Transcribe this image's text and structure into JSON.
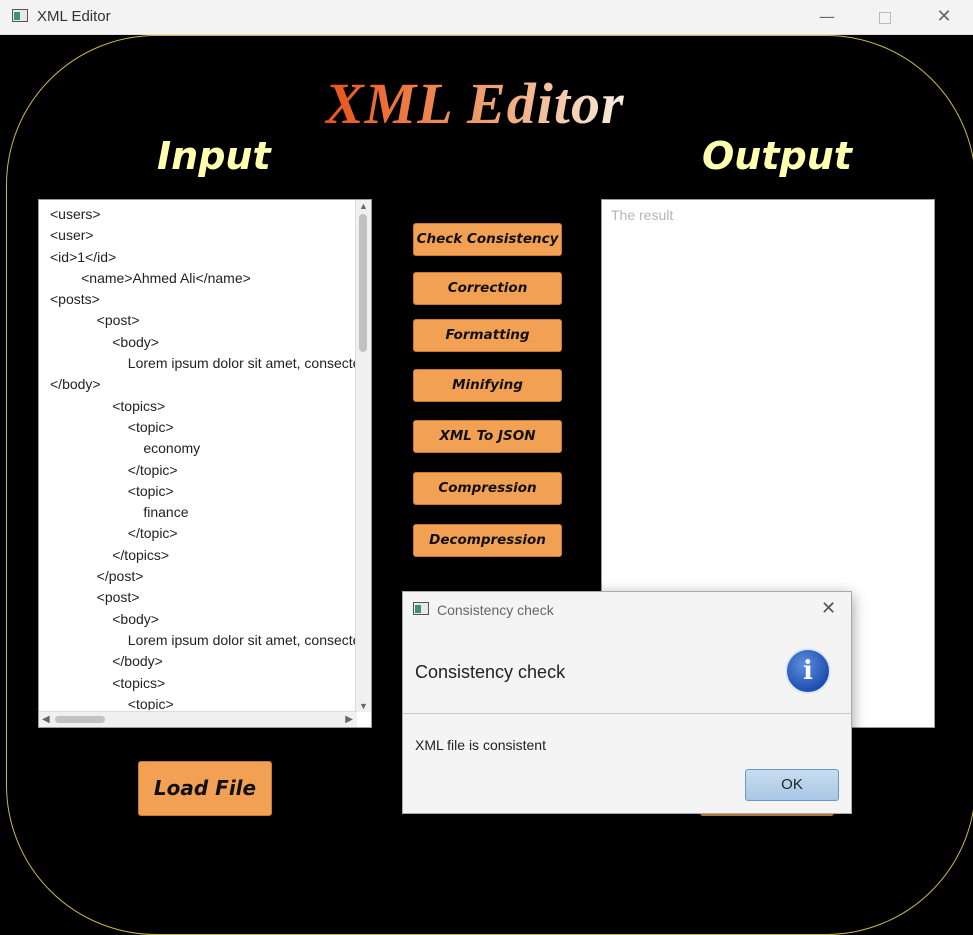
{
  "window": {
    "title": "XML Editor",
    "minimize": "—",
    "close": "✕"
  },
  "app": {
    "title": "XML Editor",
    "input_label": "Input",
    "output_label": "Output",
    "input_lines": [
      "<users>",
      "<user>",
      "<id>1</id>",
      "        <name>Ahmed Ali</name>",
      "<posts>",
      "            <post>",
      "                <body>",
      "                    Lorem ipsum dolor sit amet, consectetur",
      "</body>",
      "                <topics>",
      "                    <topic>",
      "                        economy",
      "                    </topic>",
      "                    <topic>",
      "                        finance",
      "                    </topic>",
      "                </topics>",
      "            </post>",
      "            <post>",
      "                <body>",
      "                    Lorem ipsum dolor sit amet, consectetur",
      "                </body>",
      "                <topics>",
      "                    <topic>"
    ],
    "output_placeholder": "The result",
    "buttons": {
      "check_consistency": "Check Consistency",
      "correction": "Correction",
      "formatting": "Formatting",
      "minifying": "Minifying",
      "xml_to_json": "XML To JSON",
      "compression": "Compression",
      "decompression": "Decompression",
      "load_file": "Load File"
    }
  },
  "dialog": {
    "title": "Consistency check",
    "header": "Consistency check",
    "content": "XML file is consistent",
    "ok": "OK",
    "info_glyph": "i"
  },
  "colors": {
    "button": "#f2a054",
    "label": "#ffffb0",
    "frame": "#c8b84a",
    "background": "#000000"
  }
}
